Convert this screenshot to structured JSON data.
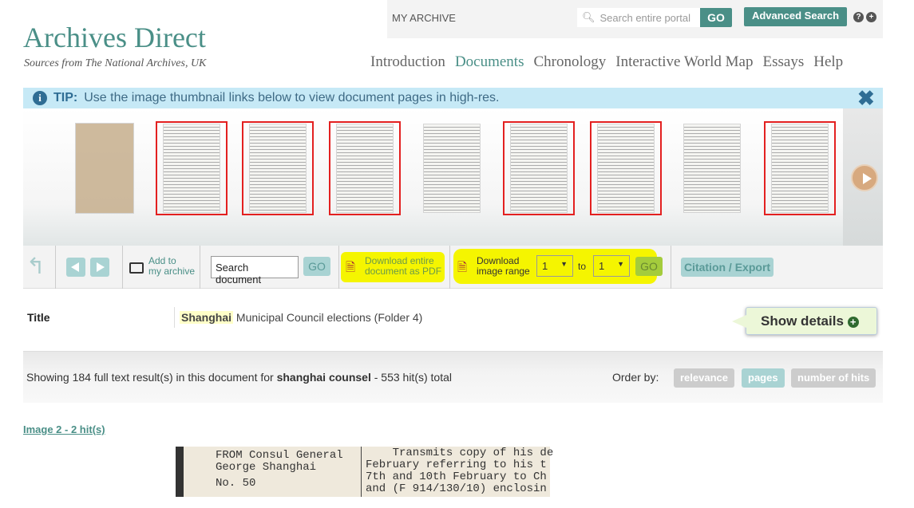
{
  "header": {
    "my_archive": "MY ARCHIVE",
    "search_placeholder": "Search entire portal",
    "go": "GO",
    "advanced_search": "Advanced Search",
    "help_icon": "?",
    "plus_icon": "+"
  },
  "logo": {
    "title": "Archives Direct",
    "subtitle": "Sources from The National Archives, UK"
  },
  "nav": [
    {
      "label": "Introduction"
    },
    {
      "label": "Documents",
      "active": true
    },
    {
      "label": "Chronology"
    },
    {
      "label": "Interactive World Map"
    },
    {
      "label": "Essays"
    },
    {
      "label": "Help"
    }
  ],
  "tip": {
    "label": "TIP:",
    "text": "Use the image thumbnail links below to view document pages in high-res."
  },
  "thumbnails": [
    {
      "highlighted": false,
      "cover": true
    },
    {
      "highlighted": true
    },
    {
      "highlighted": true
    },
    {
      "highlighted": true
    },
    {
      "highlighted": false
    },
    {
      "highlighted": true
    },
    {
      "highlighted": true
    },
    {
      "highlighted": false
    },
    {
      "highlighted": true
    }
  ],
  "toolbar": {
    "add_to_1": "Add to",
    "add_to_2": "my archive",
    "search_value": "Search document",
    "go": "GO",
    "download_pdf_1": "Download entire",
    "download_pdf_2": "document as PDF",
    "download_range_1": "Download",
    "download_range_2": "image range",
    "range_from": "1",
    "range_to_label": "to",
    "range_to": "1",
    "range_go": "GO",
    "citation": "Citation / Export"
  },
  "doc": {
    "title_label": "Title",
    "title_highlight": "Shanghai",
    "title_rest": " Municipal Council elections (Folder 4)",
    "show_details": "Show details"
  },
  "results": {
    "prefix": "Showing 184 full text result(s) in this document for ",
    "query": "shanghai counsel",
    "suffix": " - 553 hit(s) total",
    "order_by": "Order by:",
    "orders": [
      "relevance",
      "pages",
      "number of hits"
    ]
  },
  "image_link": "Image 2 - 2 hit(s)",
  "doc_image": {
    "left": [
      "FROM Consul General",
      "George Shanghai",
      "No. 50"
    ],
    "right": [
      "    Transmits copy of his de",
      "February referring to his t",
      "7th and 10th February to Ch",
      "and (F 914/130/10) enclosin"
    ]
  },
  "colors": {
    "accent": "#4a8f87",
    "highlight": "#f5f500",
    "tip_bg": "#c6e9f6"
  }
}
